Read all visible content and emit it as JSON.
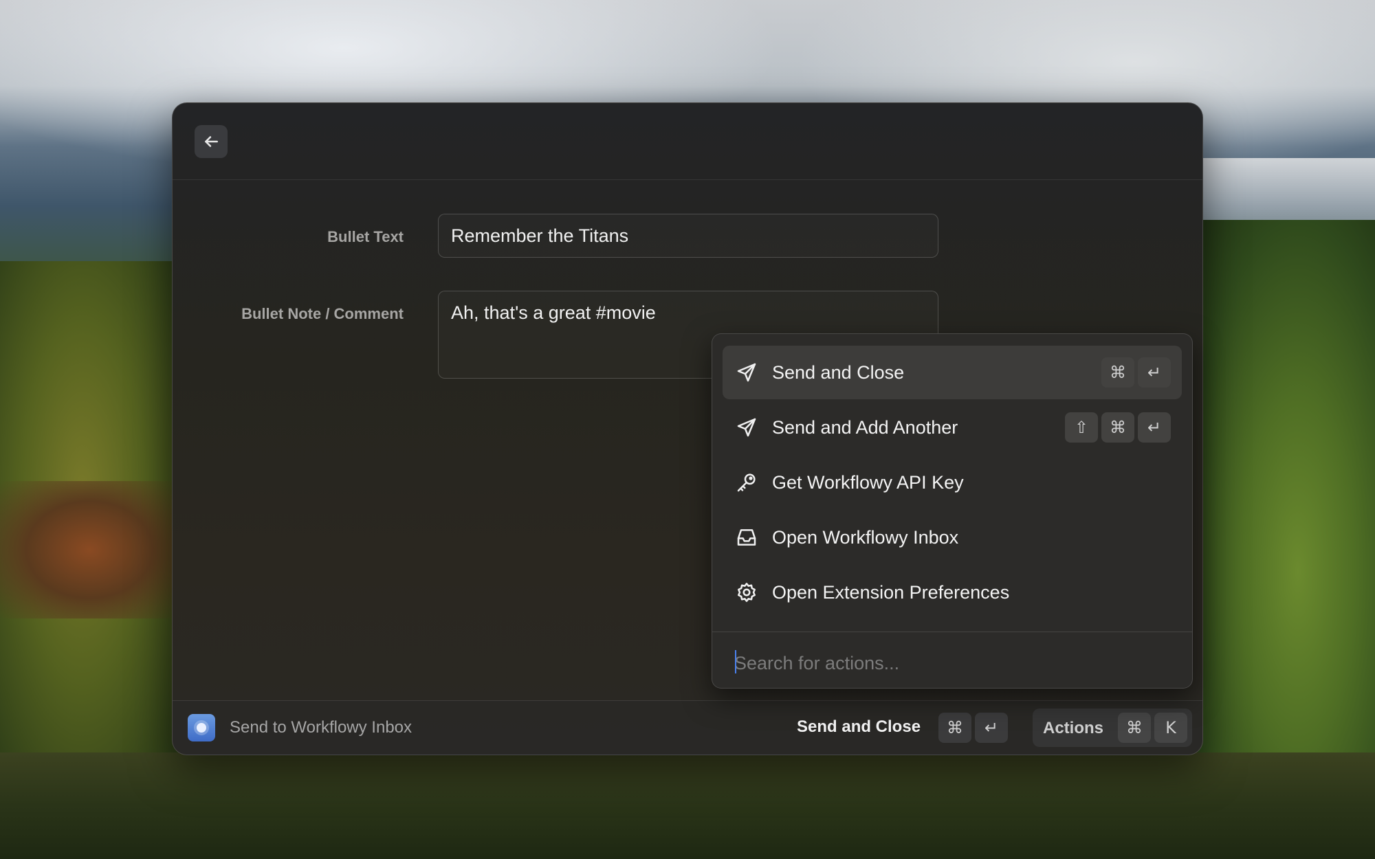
{
  "form": {
    "bullet_text_label": "Bullet Text",
    "bullet_text_value": "Remember the Titans",
    "bullet_note_label": "Bullet Note / Comment",
    "bullet_note_value": "Ah, that's a great #movie"
  },
  "footer": {
    "title": "Send to Workflowy Inbox",
    "primary_action": "Send and Close",
    "primary_shortcut": [
      "⌘",
      "↵"
    ],
    "actions_label": "Actions",
    "actions_shortcut": [
      "⌘",
      "K"
    ]
  },
  "actions_menu": {
    "items": [
      {
        "label": "Send and Close",
        "icon": "send-icon",
        "shortcut": [
          "⌘",
          "↵"
        ],
        "selected": true
      },
      {
        "label": "Send and Add Another",
        "icon": "send-icon",
        "shortcut": [
          "⇧",
          "⌘",
          "↵"
        ]
      },
      {
        "label": "Get Workflowy API Key",
        "icon": "key-icon",
        "shortcut": []
      },
      {
        "label": "Open Workflowy Inbox",
        "icon": "inbox-icon",
        "shortcut": []
      },
      {
        "label": "Open Extension Preferences",
        "icon": "gear-icon",
        "shortcut": []
      }
    ],
    "search_placeholder": "Search for actions..."
  },
  "colors": {
    "accent": "#4a82f0",
    "window_bg": "#262521",
    "popover_bg": "#2c2b29"
  }
}
